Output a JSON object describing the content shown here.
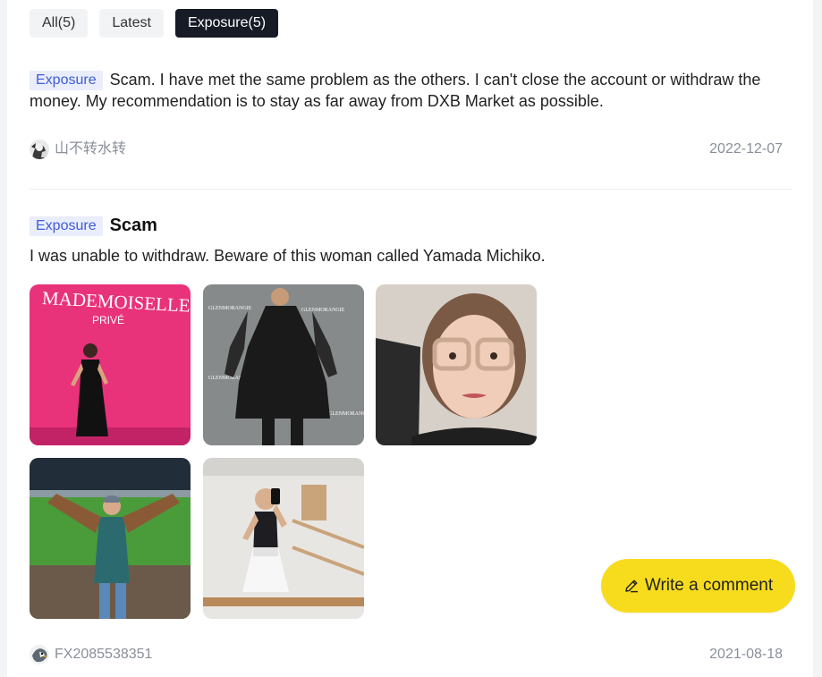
{
  "filters": [
    {
      "label": "All(5)",
      "active": false
    },
    {
      "label": "Latest",
      "active": false
    },
    {
      "label": "Exposure(5)",
      "active": true
    }
  ],
  "posts": [
    {
      "tag": "Exposure",
      "title": "",
      "text": "Scam. I have met the same problem as the others. I can't close the account or withdraw the money. My recommendation is to stay as far away from DXB Market as possible.",
      "author": "山不转水转",
      "date": "2022-12-07"
    },
    {
      "tag": "Exposure",
      "title": "Scam",
      "text": "I was unable to withdraw. Beware of this woman called Yamada Michiko.",
      "photo_texts": [
        "MADEMOISELLE",
        "PRIVÉ"
      ],
      "author": "FX2085538351",
      "date": "2021-08-18"
    }
  ],
  "write_comment": {
    "label": "Write a comment",
    "icon": "pencil-icon"
  },
  "colors": {
    "accent_yellow": "#f7dc1d",
    "tag_bg": "#eaedfb",
    "tag_text": "#3f5bd8",
    "active_tab": "#161b26"
  }
}
